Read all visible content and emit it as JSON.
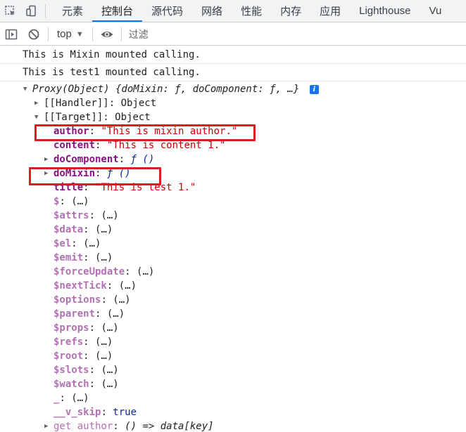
{
  "tabs": [
    "元素",
    "控制台",
    "源代码",
    "网络",
    "性能",
    "内存",
    "应用",
    "Lighthouse",
    "Vu"
  ],
  "active_tab": "控制台",
  "toolbar": {
    "context": "top",
    "filter_placeholder": "过滤"
  },
  "messages": [
    "This is Mixin mounted calling.",
    "This is test1 mounted calling."
  ],
  "tree": {
    "proxy_head": "Proxy(Object) {doMixin: ƒ, doComponent: ƒ, …}",
    "info_glyph": "i",
    "handler": "[[Handler]]",
    "handler_value": "Object",
    "target": "[[Target]]",
    "target_value": "Object",
    "author_key": "author",
    "author_value": "\"This is mixin author.\"",
    "content_key": "content",
    "content_value": "\"This is content 1.\"",
    "doComponent_key": "doComponent",
    "doComponent_value": "ƒ ()",
    "doMixin_key": "doMixin",
    "doMixin_value": "ƒ ()",
    "title_key": "title",
    "title_value": "\"This is test 1.\"",
    "private_keys": [
      "$",
      "$attrs",
      "$data",
      "$el",
      "$emit",
      "$forceUpdate",
      "$nextTick",
      "$options",
      "$parent",
      "$props",
      "$refs",
      "$root",
      "$slots",
      "$watch",
      "_"
    ],
    "ellipsis": "(…)",
    "v_skip_key": "__v_skip",
    "v_skip_value": "true",
    "get_author_key": "get author",
    "get_author_value": "() => data[key]"
  },
  "colors": {
    "highlight": "#d91f1f",
    "own_key": "#881280",
    "string": "#c80000",
    "private_key": "#b171b1",
    "accent": "#1a73e8"
  }
}
